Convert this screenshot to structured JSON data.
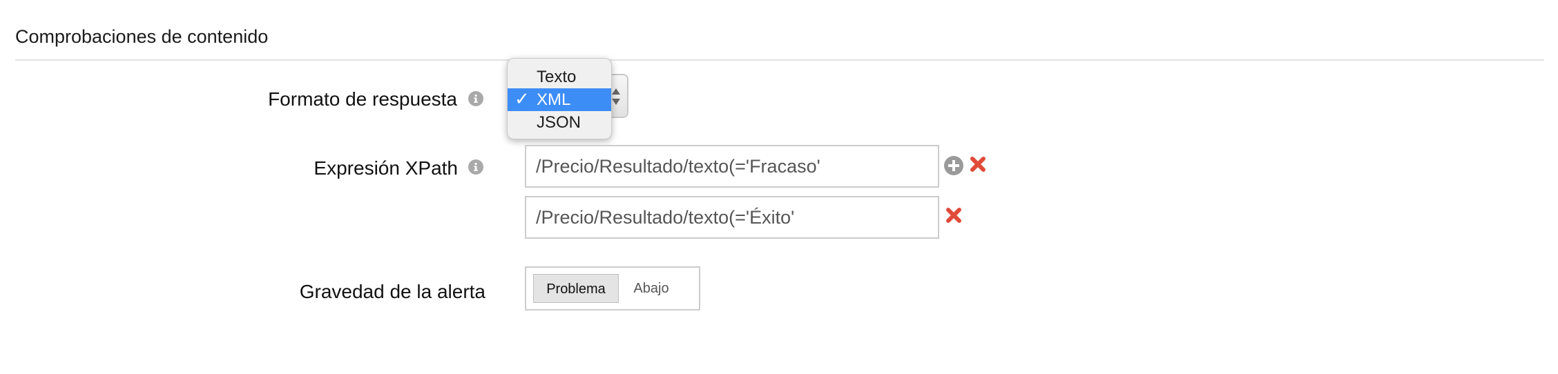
{
  "section": {
    "title": "Comprobaciones de contenido"
  },
  "fields": {
    "response_format": {
      "label": "Formato de respuesta",
      "options": [
        "Texto",
        "XML",
        "JSON"
      ],
      "selected": "XML",
      "check_mark": "✓"
    },
    "xpath": {
      "label": "Expresión XPath",
      "expressions": [
        "/Precio/Resultado/texto(='Fracaso'",
        "/Precio/Resultado/texto(='Éxito'"
      ]
    },
    "alert_severity": {
      "label": "Gravedad de la alerta",
      "options": [
        "Problema",
        "Abajo"
      ],
      "selected": "Problema"
    }
  },
  "icons": {
    "info": "info-icon",
    "add": "plus-circle-icon",
    "remove": "x-icon"
  },
  "colors": {
    "selection_blue": "#3d8df7",
    "remove_red": "#e04b3a",
    "icon_gray": "#a9a9a9"
  }
}
